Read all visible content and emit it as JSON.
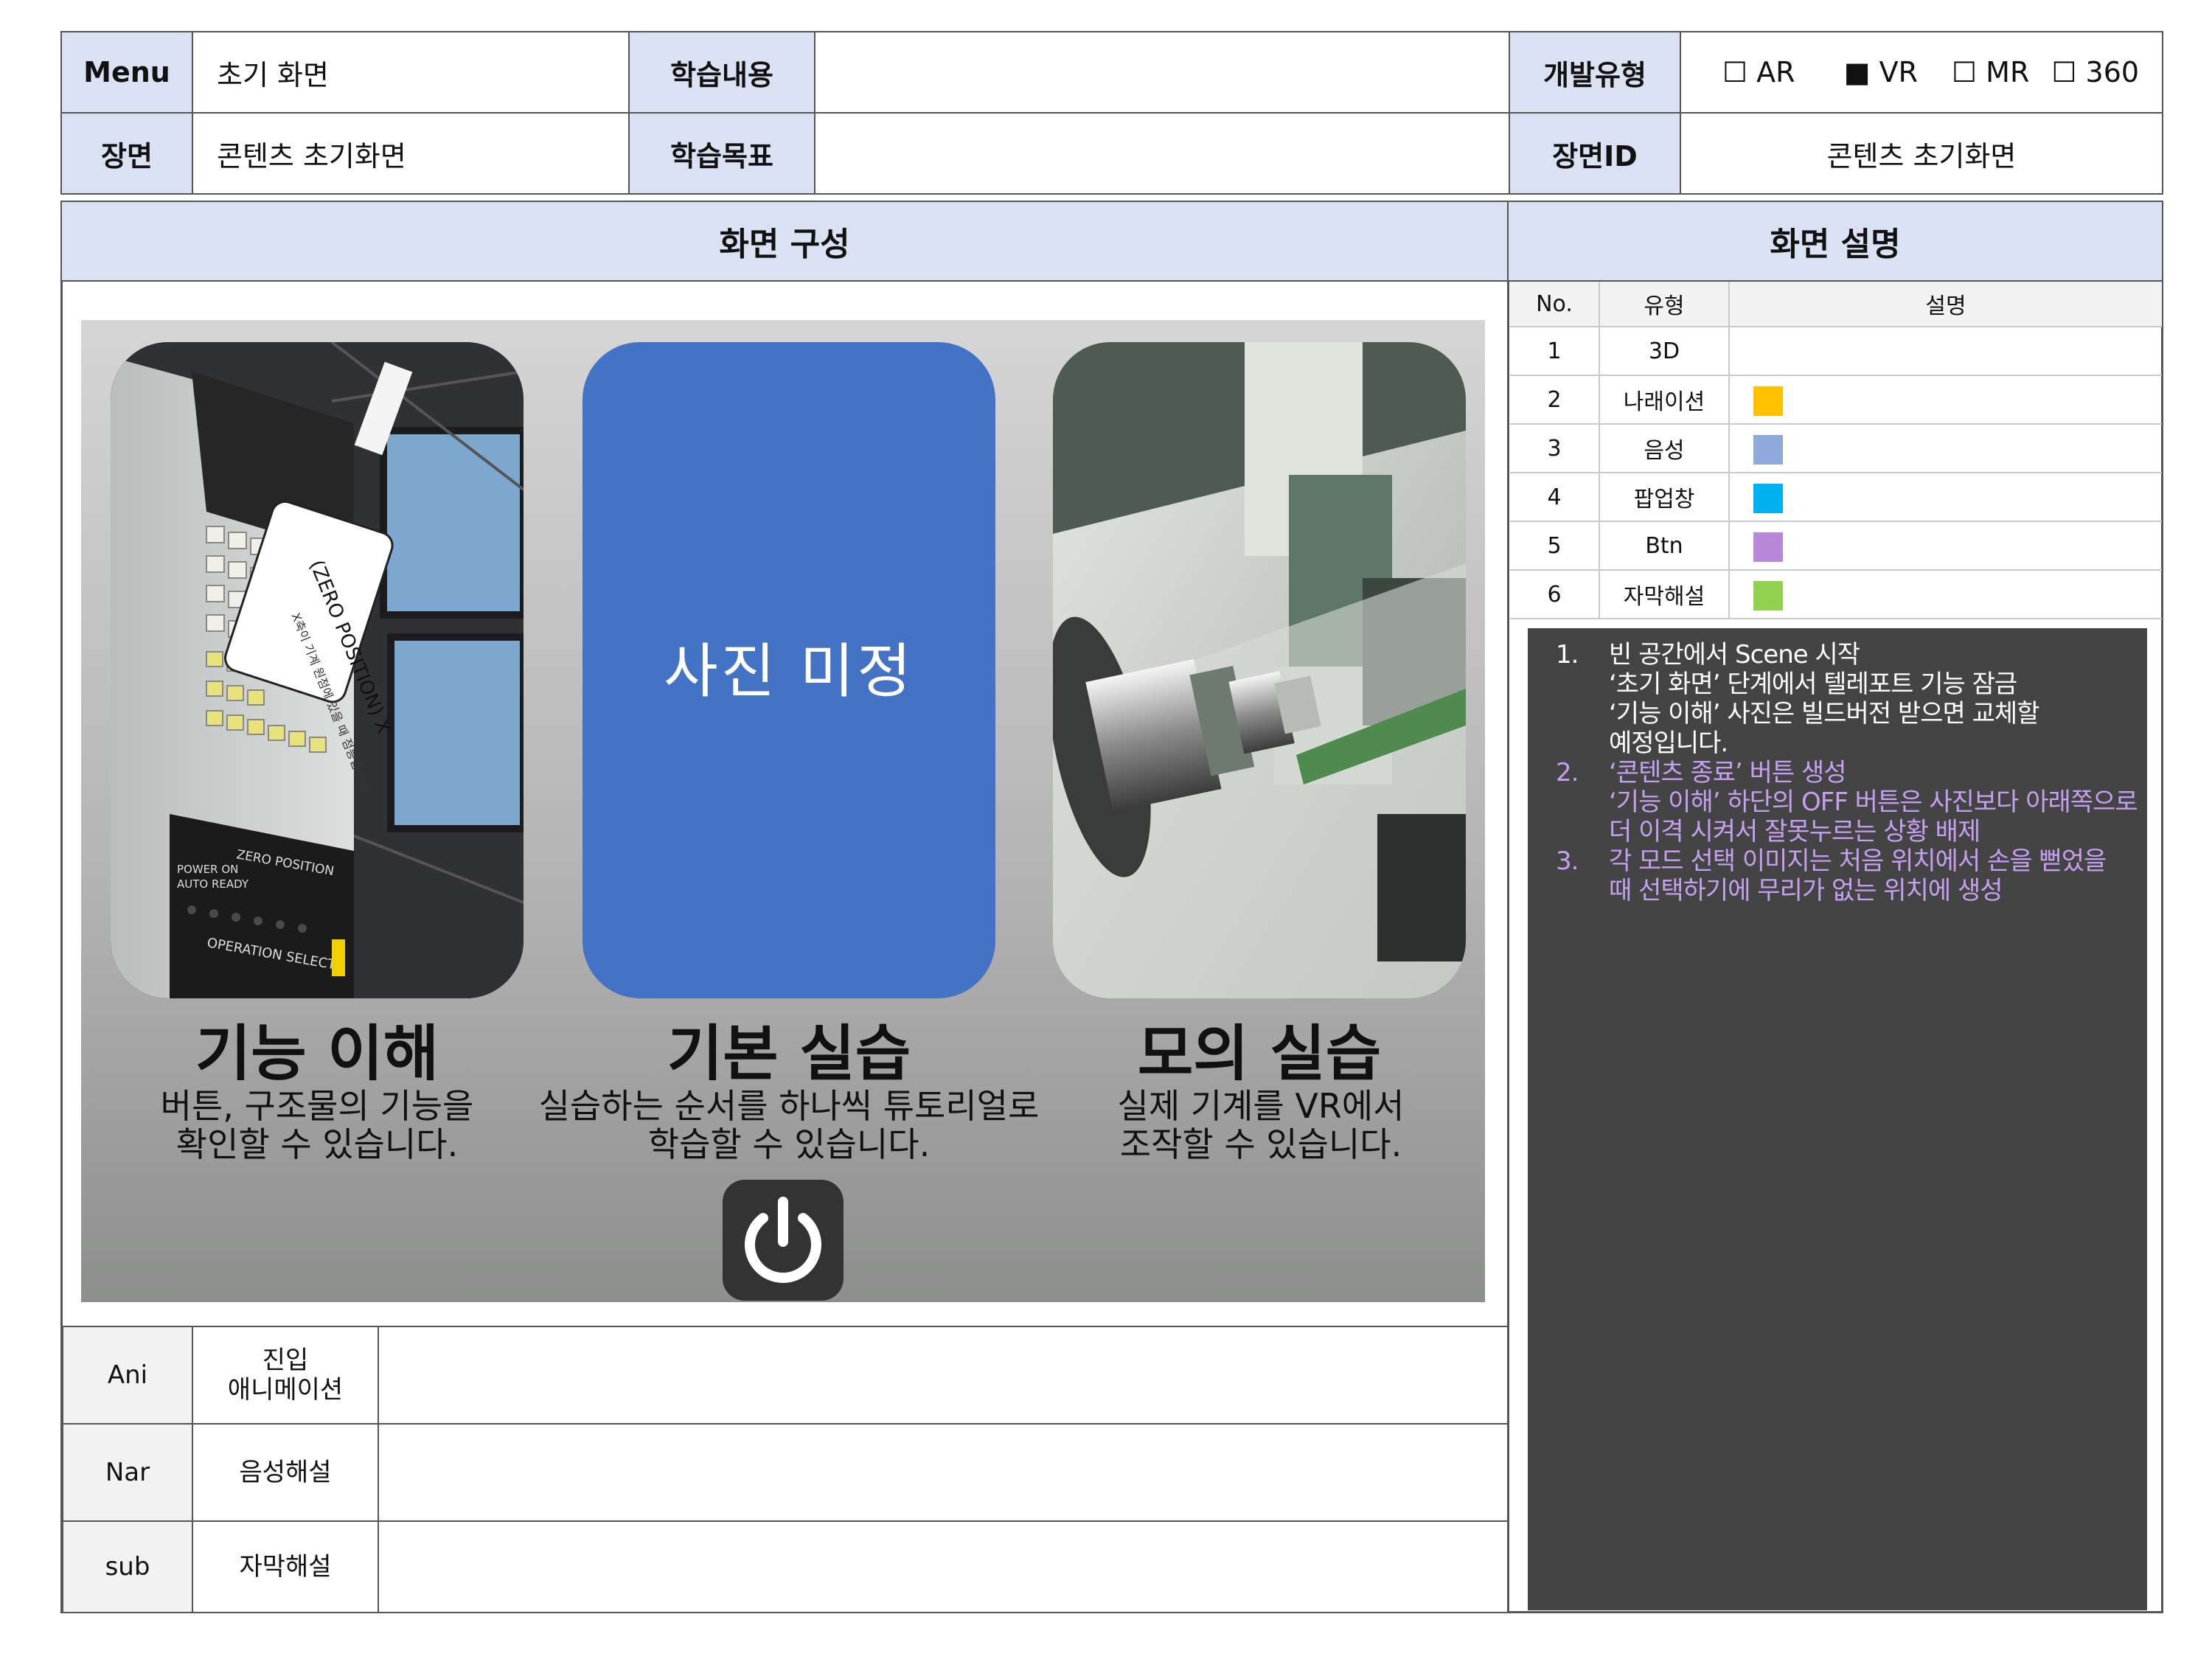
{
  "header": {
    "menu_label": "Menu",
    "menu_value": "초기 화면",
    "content_label": "학습내용",
    "content_value": "",
    "devtype_label": "개발유형",
    "devtype_options": [
      {
        "box": "☐",
        "label": "AR"
      },
      {
        "box": "■",
        "label": "VR"
      },
      {
        "box": "☐",
        "label": "MR"
      },
      {
        "box": "☐",
        "label": "360"
      }
    ],
    "scene_label": "장면",
    "scene_value": "콘텐츠 초기화면",
    "goal_label": "학습목표",
    "goal_value": "",
    "sceneid_label": "장면ID",
    "sceneid_value": "콘텐츠 초기화면"
  },
  "composition": {
    "title": "화면 구성",
    "cards": [
      {
        "title": "기능 이해",
        "desc_line1": "버튼, 구조물의 기능을",
        "desc_line2": "확인할 수 있습니다."
      },
      {
        "title": "기본 실습",
        "placeholder": "사진 미정",
        "desc_line1": "실습하는 순서를 하나씩 튜토리얼로",
        "desc_line2": "학습할 수 있습니다."
      },
      {
        "title": "모의 실습",
        "desc_line1": "실제 기계를 VR에서",
        "desc_line2": "조작할 수 있습니다."
      }
    ],
    "panel_texts": {
      "zero_title": "(ZERO POSITION) X",
      "zero_body": "X축이 기계 원점에 있을 때 점등됩니다.",
      "zero_position": "ZERO POSITION",
      "operation_select": "OPERATION SELECT",
      "indicator_labels": [
        "POWER ON",
        "AUTO READY"
      ]
    },
    "power_icon": "power-icon"
  },
  "bottom_rows": [
    {
      "code": "Ani",
      "name_line1": "진입",
      "name_line2": "애니메이션",
      "value": ""
    },
    {
      "code": "Nar",
      "name_line1": "음성해설",
      "name_line2": "",
      "value": ""
    },
    {
      "code": "sub",
      "name_line1": "자막해설",
      "name_line2": "",
      "value": ""
    }
  ],
  "description": {
    "title": "화면 설명",
    "columns": [
      "No.",
      "유형",
      "설명"
    ],
    "rows": [
      {
        "no": "1",
        "type": "3D",
        "color": ""
      },
      {
        "no": "2",
        "type": "나래이션",
        "color": "#ffc000"
      },
      {
        "no": "3",
        "type": "음성",
        "color": "#8eaadb"
      },
      {
        "no": "4",
        "type": "팝업창",
        "color": "#00b0f0"
      },
      {
        "no": "5",
        "type": "Btn",
        "color": "#b887dc"
      },
      {
        "no": "6",
        "type": "자막해설",
        "color": "#92d050"
      }
    ],
    "notes": [
      {
        "num": "1.",
        "color": "#ffffff",
        "lines": [
          "빈 공간에서 Scene 시작",
          "‘초기 화면’ 단계에서 텔레포트 기능 잠금",
          "‘기능 이해’ 사진은 빌드버전 받으면 교체할",
          "예정입니다."
        ]
      },
      {
        "num": "2.",
        "color": "#c6a0f0",
        "lines": [
          "‘콘텐츠 종료’ 버튼 생성",
          "‘기능 이해’ 하단의 OFF 버튼은 사진보다 아래쪽으로",
          "더 이격 시켜서 잘못누르는 상황 배제"
        ]
      },
      {
        "num": "3.",
        "color": "#c6a0f0",
        "lines": [
          "각 모드 선택 이미지는 처음 위치에서 손을 뻗었을",
          "때 선택하기에 무리가 없는 위치에 생성"
        ]
      }
    ]
  },
  "colors": {
    "header_fill": "#dae1f3",
    "placeholder_blue": "#4472c4",
    "notes_bg": "#444444"
  }
}
